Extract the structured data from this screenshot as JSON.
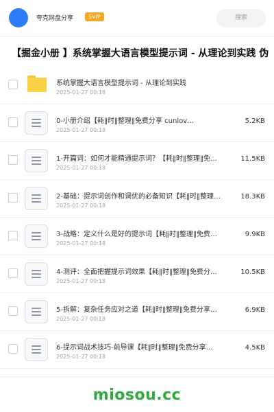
{
  "header": {
    "brand": "夸克网盘分享",
    "badge": "SVIP",
    "search_label": "搜索"
  },
  "title": "【掘金小册 】系统掌握大语言模型提示词 - 从理论到实践 伪",
  "files": [
    {
      "type": "folder",
      "name": "系统掌握大语言模型提示词 - 从理论到实践",
      "date": "2025-01-27 00:18",
      "size": ""
    },
    {
      "type": "doc",
      "name": "0-小册介绍【耗‖时‖整理‖免费分享 cunlov…",
      "date": "2025-01-27 00:18",
      "size": "5.2KB"
    },
    {
      "type": "doc",
      "name": "1-开篇词：如何才能精通提示词？【耗‖时‖整理‖免…",
      "date": "2025-01-27 00:18",
      "size": "11.5KB"
    },
    {
      "type": "doc",
      "name": "2-基础：提示词创作和调优的必备知识【耗‖时‖整理…",
      "date": "2025-01-27 00:18",
      "size": "18.3KB"
    },
    {
      "type": "doc",
      "name": "3-战略：定义什么是好的提示词【耗‖时‖整理‖免费…",
      "date": "2025-01-27 00:18",
      "size": "9.9KB"
    },
    {
      "type": "doc",
      "name": "4-测评：全面把握提示词效果【耗‖时‖整理‖免费分…",
      "date": "2025-01-27 00:18",
      "size": "10.5KB"
    },
    {
      "type": "doc",
      "name": "5-拆解：复杂任务应对之道【耗‖时‖整理‖免费分享…",
      "date": "2025-01-27 00:18",
      "size": "6.9KB"
    },
    {
      "type": "doc",
      "name": "6-提示词战术技巧-前导课【耗‖时‖整理‖免费分享…",
      "date": "2025-01-27 00:18",
      "size": "4.5KB"
    }
  ],
  "watermark": "miosou.cc",
  "colors": {
    "avatar": "#2f7df6",
    "svip_badge": "#f5a623",
    "folder": "#fad044",
    "watermark": "#2eaa3f"
  }
}
